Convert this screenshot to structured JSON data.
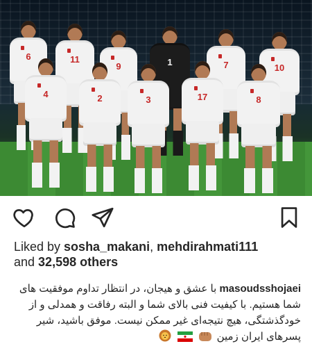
{
  "post": {
    "players": [
      {
        "number": "6"
      },
      {
        "number": "11"
      },
      {
        "number": "9"
      },
      {
        "number": "1"
      },
      {
        "number": "7"
      },
      {
        "number": "10"
      },
      {
        "number": "4"
      },
      {
        "number": "2"
      },
      {
        "number": "3"
      },
      {
        "number": "17"
      },
      {
        "number": "8"
      }
    ]
  },
  "actions": {
    "like_icon": "heart-icon",
    "comment_icon": "comment-icon",
    "share_icon": "paper-plane-icon",
    "save_icon": "bookmark-icon"
  },
  "likes": {
    "prefix": "Liked by ",
    "user1": "sosha_makani",
    "separator": ", ",
    "user2": "mehdirahmati111",
    "and": "and ",
    "count": "32,598",
    "suffix": " others"
  },
  "caption": {
    "username": "masoudsshojaei",
    "text": "با عشق و هیجان، در انتظار تداوم موفقیت های شما هستیم. با کیفیت فنی بالای شما و البته رفاقت و همدلی و از خودگذشتگی، هیچ نتیجه‌ای غیر ممکن نیست. موفق باشید، شیر پسرهای ایران زمین",
    "emojis": [
      "fist-emoji",
      "iran-flag-emoji",
      "lion-emoji"
    ]
  },
  "colors": {
    "text": "#262626",
    "jersey": "#f2f2f2",
    "jersey_number": "#c62828"
  }
}
